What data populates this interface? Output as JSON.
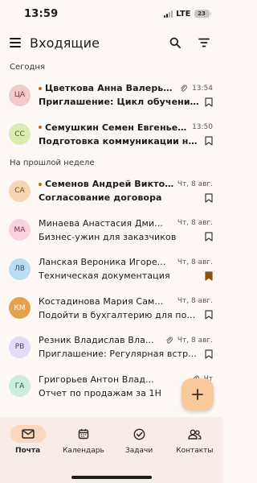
{
  "status_bar": {
    "time": "13:59",
    "network": "LTE",
    "battery": "23"
  },
  "app_bar": {
    "title": "Входящие"
  },
  "sections": [
    {
      "header": "Сегодня",
      "items": [
        {
          "initials": "ЦА",
          "avatar_bg": "#f2c9cd",
          "avatar_fg": "#7a2f3a",
          "sender": "Цветкова Анна Валерьев...",
          "subject": "Приглашение: Цикл обучения. Т...",
          "date": "13:54",
          "unread": true,
          "attachment": true,
          "flagged": false
        },
        {
          "initials": "СС",
          "avatar_bg": "#dceab4",
          "avatar_fg": "#3f5a14",
          "sender": "Семушкин Семен Евгеньев...",
          "subject": "Подготовка коммуникации на ко...",
          "date": "13:50",
          "unread": true,
          "attachment": false,
          "flagged": false
        }
      ]
    },
    {
      "header": "На прошлой неделе",
      "items": [
        {
          "initials": "СА",
          "avatar_bg": "#f6d6b2",
          "avatar_fg": "#7a4a14",
          "sender": "Семенов Андрей Виктор...",
          "subject": "Согласование договора",
          "date": "Чт, 8 авг.",
          "unread": true,
          "attachment": false,
          "flagged": false
        },
        {
          "initials": "МА",
          "avatar_bg": "#f7d3df",
          "avatar_fg": "#7a2f4a",
          "sender": "Минаева Анастасия Дми...",
          "subject": "Бизнес-ужин для заказчиков",
          "date": "Чт, 8 авг.",
          "unread": false,
          "attachment": false,
          "flagged": false
        },
        {
          "initials": "ЛВ",
          "avatar_bg": "#bcdcf0",
          "avatar_fg": "#1f4f72",
          "sender": "Ланская Вероника Игоре...",
          "subject": "Техническая документация",
          "date": "Чт, 8 авг.",
          "unread": false,
          "attachment": false,
          "flagged": true
        },
        {
          "initials": "КМ",
          "avatar_bg": "#e6a24a",
          "avatar_fg": "#ffffff",
          "sender": "Костадинова Мария Сам...",
          "subject": "Подойти в бухгалтерию для под...",
          "date": "Чт, 8 авг.",
          "unread": false,
          "attachment": false,
          "flagged": false
        },
        {
          "initials": "РВ",
          "avatar_bg": "#e2dcf6",
          "avatar_fg": "#4a3f80",
          "sender": "Резник Владислав Вла...",
          "subject": "Приглашение: Регулярная встр...",
          "date": "Чт, 8 авг.",
          "unread": false,
          "attachment": true,
          "flagged": false
        },
        {
          "initials": "ГА",
          "avatar_bg": "#cdeede",
          "avatar_fg": "#1f5c3e",
          "sender": "Григорьев Антон Влад...",
          "subject": "Отчет по продажам за 1Н",
          "date": "Чт",
          "unread": false,
          "attachment": true,
          "flagged": false
        }
      ]
    }
  ],
  "bottom_nav": [
    {
      "label": "Почта",
      "icon": "mail-icon",
      "active": true
    },
    {
      "label": "Календарь",
      "icon": "calendar-icon",
      "active": false
    },
    {
      "label": "Задачи",
      "icon": "tasks-icon",
      "active": false
    },
    {
      "label": "Контакты",
      "icon": "contacts-icon",
      "active": false
    }
  ],
  "colors": {
    "accent": "#b56a1f",
    "fab": "#fac99b",
    "nav_active": "#fbd8bd",
    "background": "#fdf8f6"
  }
}
